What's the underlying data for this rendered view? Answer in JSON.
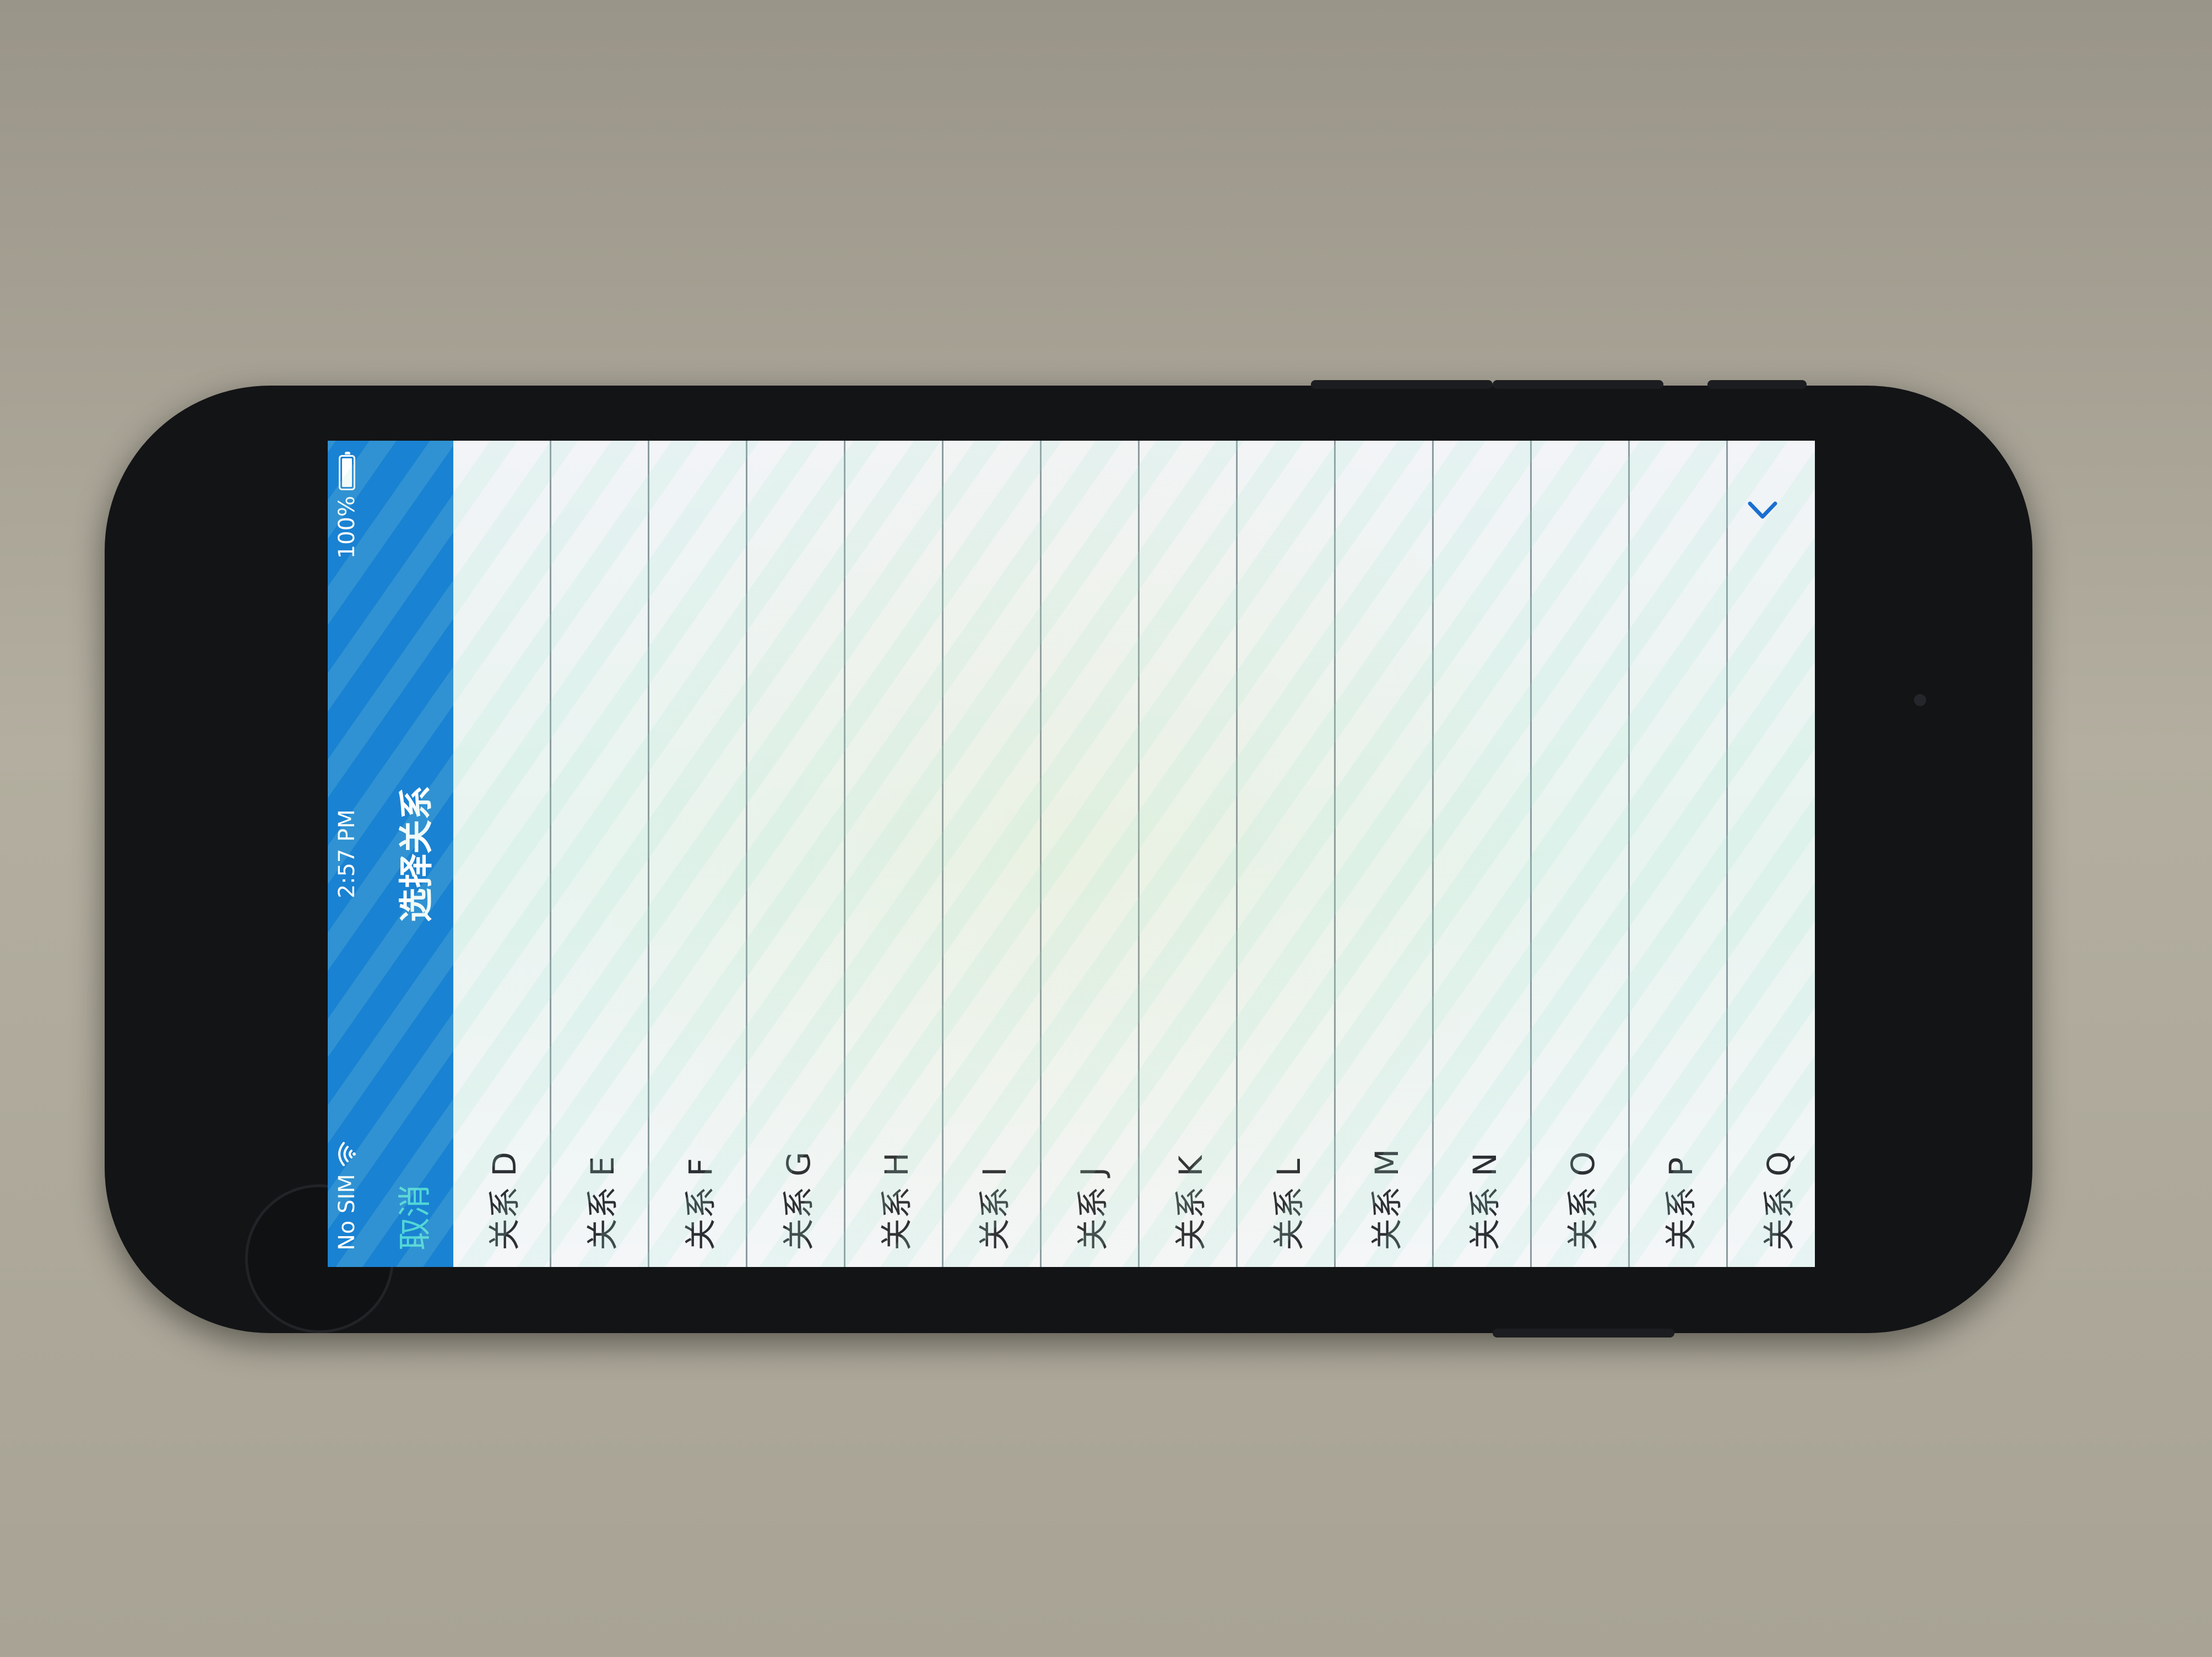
{
  "status_bar": {
    "carrier": "No SIM",
    "time": "2:57 PM",
    "battery": "100%",
    "battery_level": 1.0
  },
  "nav": {
    "title": "选择关系",
    "cancel_label": "取消"
  },
  "relations": [
    {
      "label": "关系 D"
    },
    {
      "label": "关系 E"
    },
    {
      "label": "关系 F"
    },
    {
      "label": "关系 G"
    },
    {
      "label": "关系 H"
    },
    {
      "label": "关系 I"
    },
    {
      "label": "关系 J"
    },
    {
      "label": "关系 K"
    },
    {
      "label": "关系 L"
    },
    {
      "label": "关系 M"
    },
    {
      "label": "关系 N"
    },
    {
      "label": "关系 O"
    },
    {
      "label": "关系 P"
    },
    {
      "label": "关系 Q"
    }
  ],
  "icons": {
    "wifi": "wifi-icon",
    "battery": "battery-icon",
    "back": "chevron-left-icon"
  },
  "colors": {
    "nav_background": "#1a82d2",
    "cancel_text": "#52d6d6",
    "accent": "#1a6fd0"
  }
}
